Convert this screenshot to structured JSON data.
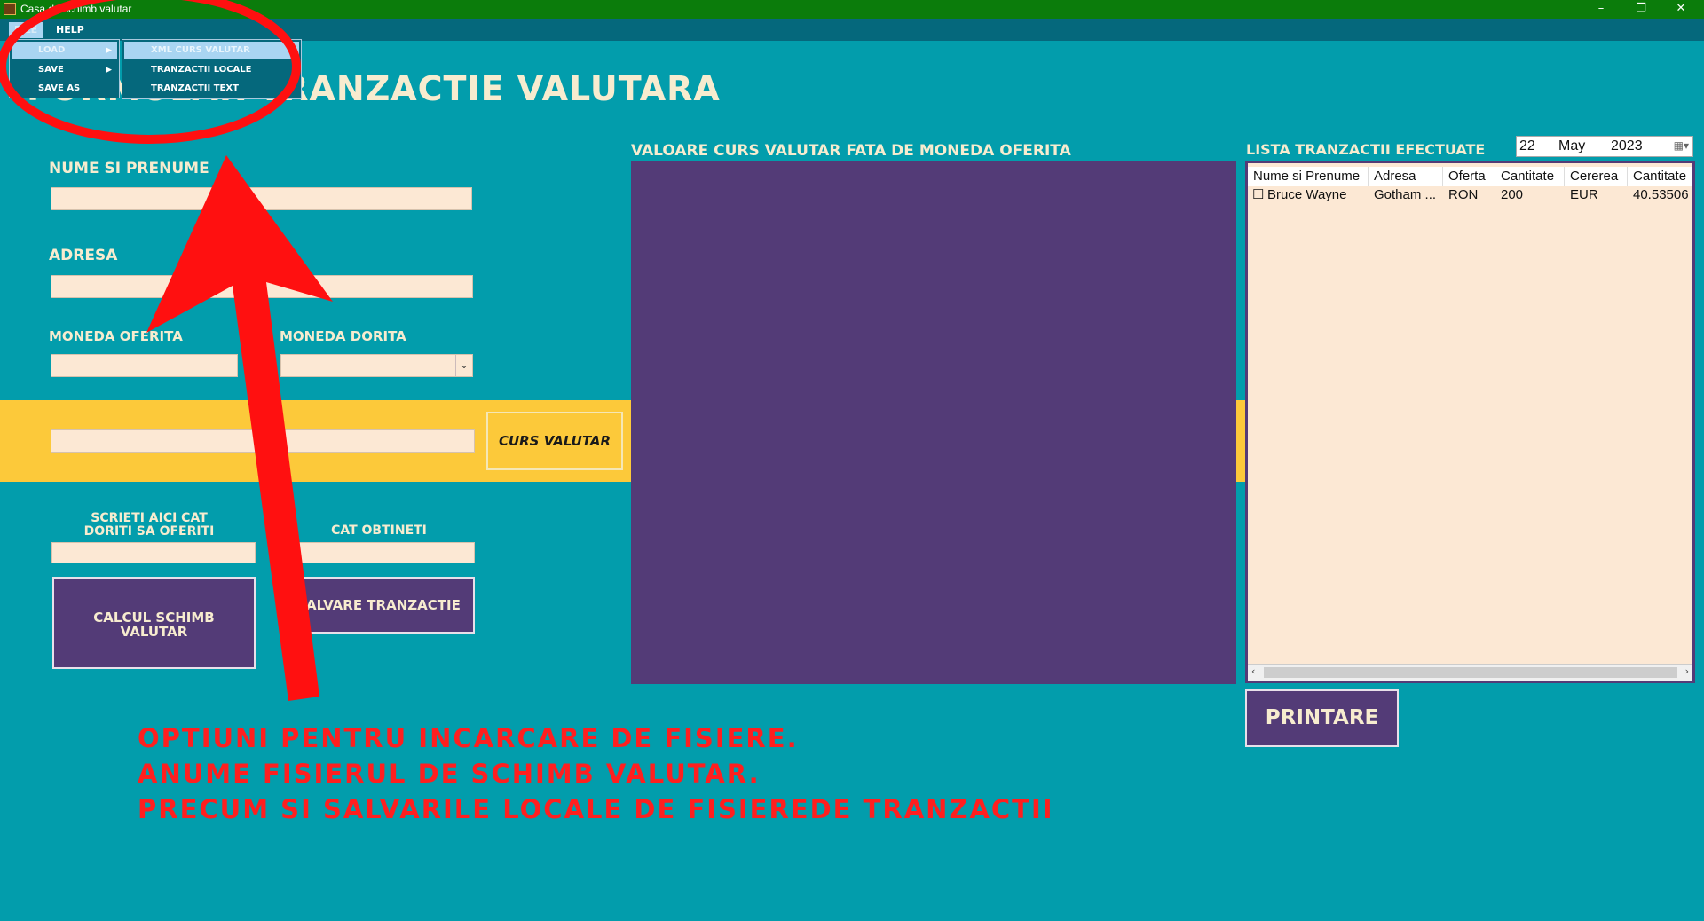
{
  "window": {
    "title": "Casa de schimb valutar",
    "minimize": "–",
    "restore": "❐",
    "close": "✕"
  },
  "menu": {
    "file": "FILE",
    "help": "HELP",
    "file_items": [
      "LOAD",
      "SAVE",
      "SAVE AS"
    ],
    "load_submenu": [
      "XML CURS VALUTAR",
      "TRANZACTII LOCALE",
      "TRANZACTII TEXT"
    ]
  },
  "page_title": "FORMULAR TRANZACTIE VALUTARA",
  "form": {
    "name_label": "NUME SI PRENUME",
    "name_value": "",
    "address_label": "ADRESA",
    "address_value": "",
    "offered_label": "MONEDA OFERITA",
    "desired_label": "MONEDA DORITA",
    "curs_button": "CURS VALUTAR",
    "amount_label": "SCRIETI AICI CAT\nDORITI SA OFERITI",
    "obtain_label": "CAT OBTINETI",
    "calc_button": "CALCUL SCHIMB\nVALUTAR",
    "save_button": "SALVARE TRANZACTIE"
  },
  "rate_panel_title": "VALOARE CURS VALUTAR FATA DE MONEDA OFERITA",
  "list": {
    "title": "LISTA TRANZACTII EFECTUATE",
    "date": {
      "day": "22",
      "month": "May",
      "year": "2023"
    },
    "columns": [
      "Nume si Prenume",
      "Adresa",
      "Oferta",
      "Cantitate",
      "Cererea",
      "Cantitate"
    ],
    "rows": [
      {
        "checked": false,
        "cells": [
          "Bruce Wayne",
          "Gotham ...",
          "RON",
          "200",
          "EUR",
          "40.53506"
        ]
      }
    ],
    "print_button": "PRINTARE"
  },
  "annotation": {
    "lines": [
      "OPTIUNI PENTRU INCARCARE DE FISIERE.",
      "ANUME FISIERUL DE SCHIMB VALUTAR.",
      "PRECUM SI SALVARILE LOCALE DE FISIEREDE TRANZACTII"
    ],
    "color": "#FF1F1F"
  },
  "colors": {
    "background": "#029DAC",
    "accent_purple": "#533B77",
    "accent_yellow": "#FCC93A",
    "field": "#FCE8D4",
    "titlebar": "#0B7C0B"
  }
}
